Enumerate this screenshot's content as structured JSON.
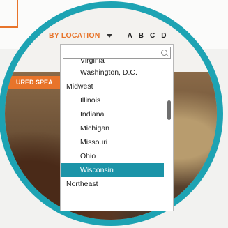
{
  "header": {
    "filter_label": "BY LOCATION",
    "alphabet": [
      "A",
      "B",
      "C",
      "D"
    ]
  },
  "tag": {
    "label": "URED SPEA"
  },
  "dropdown": {
    "search_placeholder": "",
    "items": [
      {
        "label": "Virginia",
        "kind": "state"
      },
      {
        "label": "Washington, D.C.",
        "kind": "state"
      },
      {
        "label": "Midwest",
        "kind": "group"
      },
      {
        "label": "Illinois",
        "kind": "state"
      },
      {
        "label": "Indiana",
        "kind": "state"
      },
      {
        "label": "Michigan",
        "kind": "state"
      },
      {
        "label": "Missouri",
        "kind": "state"
      },
      {
        "label": "Ohio",
        "kind": "state"
      },
      {
        "label": "Wisconsin",
        "kind": "state",
        "selected": true
      },
      {
        "label": "Northeast",
        "kind": "group"
      }
    ]
  },
  "colors": {
    "accent": "#e8742a",
    "lens": "#1da3b3",
    "selected": "#1b94a8"
  },
  "icons": {
    "search": "search-icon",
    "dropdown": "caret-down-icon"
  }
}
